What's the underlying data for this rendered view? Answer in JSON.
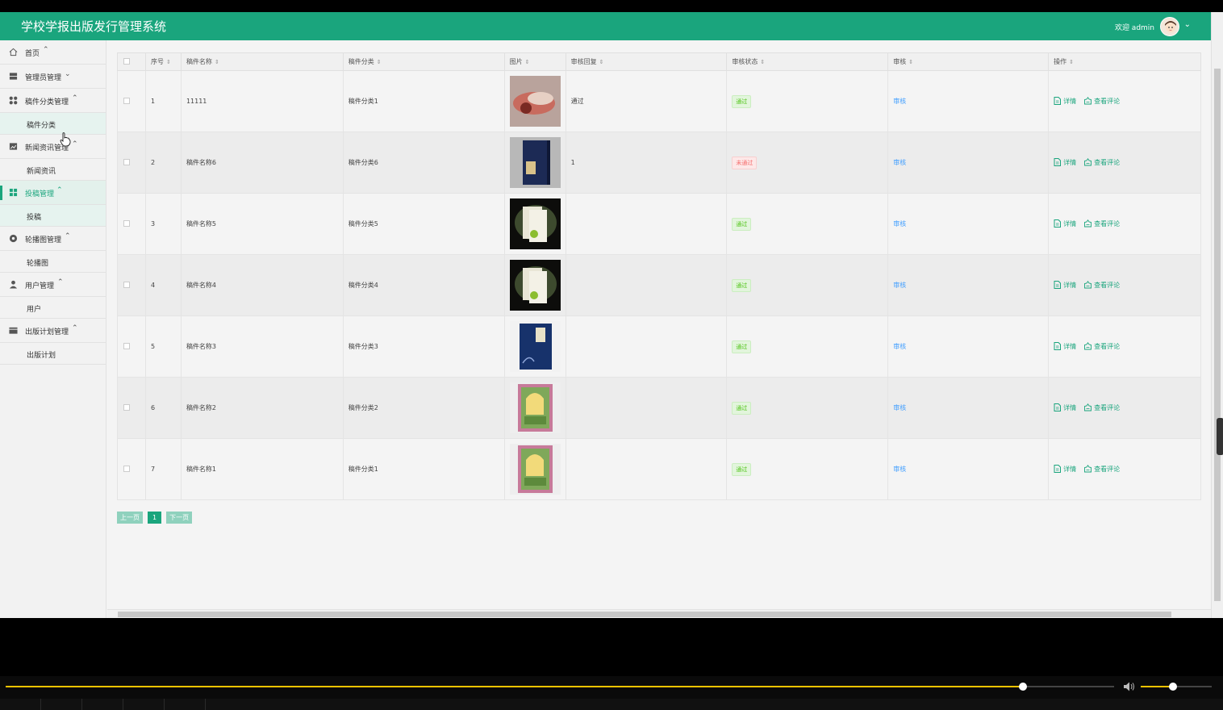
{
  "app": {
    "title": "学校学报出版发行管理系统",
    "welcome": "欢迎 admin",
    "accent": "#1aa57d"
  },
  "sidebar": {
    "items": [
      {
        "label": "首页",
        "icon": "home-icon",
        "arrow": "^"
      },
      {
        "label": "管理员管理",
        "icon": "server-icon",
        "arrow": "v"
      },
      {
        "label": "稿件分类管理",
        "icon": "apps-icon",
        "arrow": "^",
        "sub": "稿件分类"
      },
      {
        "label": "新闻资讯管理",
        "icon": "picture-icon",
        "arrow": "^",
        "sub": "新闻资讯"
      },
      {
        "label": "投稿管理",
        "icon": "grid-icon",
        "arrow": "^",
        "sub": "投稿"
      },
      {
        "label": "轮播图管理",
        "icon": "circle-icon",
        "arrow": "^",
        "sub": "轮播图"
      },
      {
        "label": "用户管理",
        "icon": "user-icon",
        "arrow": "^",
        "sub": "用户"
      },
      {
        "label": "出版计划管理",
        "icon": "folder-icon",
        "arrow": "^",
        "sub": "出版计划"
      }
    ]
  },
  "table": {
    "headers": [
      "序号",
      "稿件名称",
      "稿件分类",
      "图片",
      "审核回复",
      "审核状态",
      "审核",
      "操作"
    ],
    "rows": [
      {
        "no": "1",
        "name": "11111",
        "category": "稿件分类1",
        "reply": "通过",
        "status": "通过",
        "pass": true
      },
      {
        "no": "2",
        "name": "稿件名称6",
        "category": "稿件分类6",
        "reply": "1",
        "status": "未通过",
        "pass": false
      },
      {
        "no": "3",
        "name": "稿件名称5",
        "category": "稿件分类5",
        "reply": "",
        "status": "通过",
        "pass": true
      },
      {
        "no": "4",
        "name": "稿件名称4",
        "category": "稿件分类4",
        "reply": "",
        "status": "通过",
        "pass": true
      },
      {
        "no": "5",
        "name": "稿件名称3",
        "category": "稿件分类3",
        "reply": "",
        "status": "通过",
        "pass": true
      },
      {
        "no": "6",
        "name": "稿件名称2",
        "category": "稿件分类2",
        "reply": "",
        "status": "通过",
        "pass": true
      },
      {
        "no": "7",
        "name": "稿件名称1",
        "category": "稿件分类1",
        "reply": "",
        "status": "通过",
        "pass": true
      }
    ],
    "audit_link": "审核",
    "detail_label": "详情",
    "comments_label": "查看评论"
  },
  "pager": {
    "prev": "上一页",
    "current": "1",
    "next": "下一页"
  },
  "player": {
    "progress": 0.918,
    "volume": 0.45
  }
}
